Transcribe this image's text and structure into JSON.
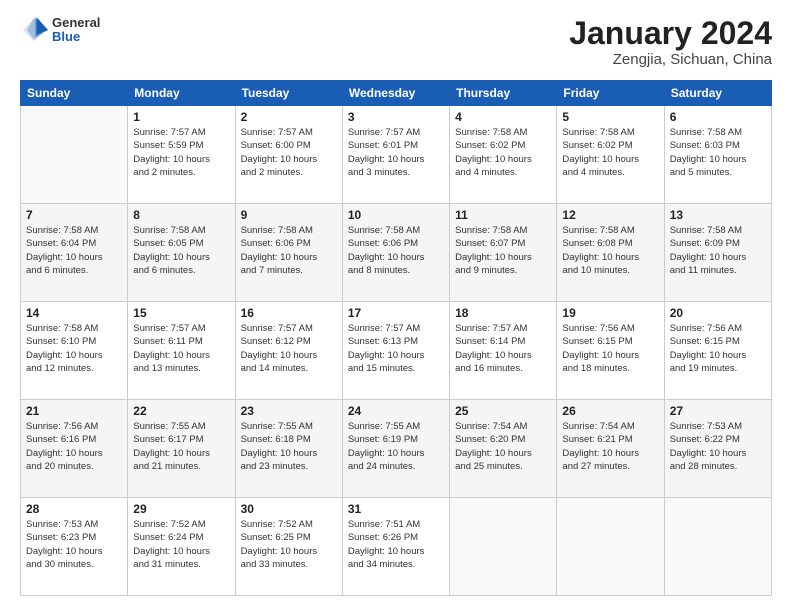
{
  "logo": {
    "general": "General",
    "blue": "Blue"
  },
  "title": "January 2024",
  "location": "Zengjia, Sichuan, China",
  "days_of_week": [
    "Sunday",
    "Monday",
    "Tuesday",
    "Wednesday",
    "Thursday",
    "Friday",
    "Saturday"
  ],
  "weeks": [
    [
      {
        "day": "",
        "info": ""
      },
      {
        "day": "1",
        "info": "Sunrise: 7:57 AM\nSunset: 5:59 PM\nDaylight: 10 hours\nand 2 minutes."
      },
      {
        "day": "2",
        "info": "Sunrise: 7:57 AM\nSunset: 6:00 PM\nDaylight: 10 hours\nand 2 minutes."
      },
      {
        "day": "3",
        "info": "Sunrise: 7:57 AM\nSunset: 6:01 PM\nDaylight: 10 hours\nand 3 minutes."
      },
      {
        "day": "4",
        "info": "Sunrise: 7:58 AM\nSunset: 6:02 PM\nDaylight: 10 hours\nand 4 minutes."
      },
      {
        "day": "5",
        "info": "Sunrise: 7:58 AM\nSunset: 6:02 PM\nDaylight: 10 hours\nand 4 minutes."
      },
      {
        "day": "6",
        "info": "Sunrise: 7:58 AM\nSunset: 6:03 PM\nDaylight: 10 hours\nand 5 minutes."
      }
    ],
    [
      {
        "day": "7",
        "info": "Sunrise: 7:58 AM\nSunset: 6:04 PM\nDaylight: 10 hours\nand 6 minutes."
      },
      {
        "day": "8",
        "info": "Sunrise: 7:58 AM\nSunset: 6:05 PM\nDaylight: 10 hours\nand 6 minutes."
      },
      {
        "day": "9",
        "info": "Sunrise: 7:58 AM\nSunset: 6:06 PM\nDaylight: 10 hours\nand 7 minutes."
      },
      {
        "day": "10",
        "info": "Sunrise: 7:58 AM\nSunset: 6:06 PM\nDaylight: 10 hours\nand 8 minutes."
      },
      {
        "day": "11",
        "info": "Sunrise: 7:58 AM\nSunset: 6:07 PM\nDaylight: 10 hours\nand 9 minutes."
      },
      {
        "day": "12",
        "info": "Sunrise: 7:58 AM\nSunset: 6:08 PM\nDaylight: 10 hours\nand 10 minutes."
      },
      {
        "day": "13",
        "info": "Sunrise: 7:58 AM\nSunset: 6:09 PM\nDaylight: 10 hours\nand 11 minutes."
      }
    ],
    [
      {
        "day": "14",
        "info": "Sunrise: 7:58 AM\nSunset: 6:10 PM\nDaylight: 10 hours\nand 12 minutes."
      },
      {
        "day": "15",
        "info": "Sunrise: 7:57 AM\nSunset: 6:11 PM\nDaylight: 10 hours\nand 13 minutes."
      },
      {
        "day": "16",
        "info": "Sunrise: 7:57 AM\nSunset: 6:12 PM\nDaylight: 10 hours\nand 14 minutes."
      },
      {
        "day": "17",
        "info": "Sunrise: 7:57 AM\nSunset: 6:13 PM\nDaylight: 10 hours\nand 15 minutes."
      },
      {
        "day": "18",
        "info": "Sunrise: 7:57 AM\nSunset: 6:14 PM\nDaylight: 10 hours\nand 16 minutes."
      },
      {
        "day": "19",
        "info": "Sunrise: 7:56 AM\nSunset: 6:15 PM\nDaylight: 10 hours\nand 18 minutes."
      },
      {
        "day": "20",
        "info": "Sunrise: 7:56 AM\nSunset: 6:15 PM\nDaylight: 10 hours\nand 19 minutes."
      }
    ],
    [
      {
        "day": "21",
        "info": "Sunrise: 7:56 AM\nSunset: 6:16 PM\nDaylight: 10 hours\nand 20 minutes."
      },
      {
        "day": "22",
        "info": "Sunrise: 7:55 AM\nSunset: 6:17 PM\nDaylight: 10 hours\nand 21 minutes."
      },
      {
        "day": "23",
        "info": "Sunrise: 7:55 AM\nSunset: 6:18 PM\nDaylight: 10 hours\nand 23 minutes."
      },
      {
        "day": "24",
        "info": "Sunrise: 7:55 AM\nSunset: 6:19 PM\nDaylight: 10 hours\nand 24 minutes."
      },
      {
        "day": "25",
        "info": "Sunrise: 7:54 AM\nSunset: 6:20 PM\nDaylight: 10 hours\nand 25 minutes."
      },
      {
        "day": "26",
        "info": "Sunrise: 7:54 AM\nSunset: 6:21 PM\nDaylight: 10 hours\nand 27 minutes."
      },
      {
        "day": "27",
        "info": "Sunrise: 7:53 AM\nSunset: 6:22 PM\nDaylight: 10 hours\nand 28 minutes."
      }
    ],
    [
      {
        "day": "28",
        "info": "Sunrise: 7:53 AM\nSunset: 6:23 PM\nDaylight: 10 hours\nand 30 minutes."
      },
      {
        "day": "29",
        "info": "Sunrise: 7:52 AM\nSunset: 6:24 PM\nDaylight: 10 hours\nand 31 minutes."
      },
      {
        "day": "30",
        "info": "Sunrise: 7:52 AM\nSunset: 6:25 PM\nDaylight: 10 hours\nand 33 minutes."
      },
      {
        "day": "31",
        "info": "Sunrise: 7:51 AM\nSunset: 6:26 PM\nDaylight: 10 hours\nand 34 minutes."
      },
      {
        "day": "",
        "info": ""
      },
      {
        "day": "",
        "info": ""
      },
      {
        "day": "",
        "info": ""
      }
    ]
  ]
}
